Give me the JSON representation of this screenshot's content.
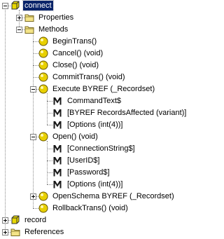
{
  "tree": {
    "nodes": [
      {
        "label": "connect",
        "icon": "module-icon",
        "level": 0,
        "expander": "minus",
        "selected": true
      },
      {
        "label": "Properties",
        "icon": "folder-icon",
        "level": 1,
        "expander": "plus"
      },
      {
        "label": "Methods",
        "icon": "folder-icon",
        "level": 1,
        "expander": "minus"
      },
      {
        "label": "BeginTrans()",
        "icon": "method-icon",
        "level": 2,
        "expander": null
      },
      {
        "label": "Cancel() (void)",
        "icon": "method-icon",
        "level": 2,
        "expander": null
      },
      {
        "label": "Close() (void)",
        "icon": "method-icon",
        "level": 2,
        "expander": null
      },
      {
        "label": "CommitTrans() (void)",
        "icon": "method-icon",
        "level": 2,
        "expander": null
      },
      {
        "label": "Execute BYREF (_Recordset)",
        "icon": "method-icon",
        "level": 2,
        "expander": "minus"
      },
      {
        "label": "CommandText$",
        "icon": "parameter-icon",
        "level": 3,
        "expander": null
      },
      {
        "label": "[BYREF RecordsAffected (variant)]",
        "icon": "parameter-icon",
        "level": 3,
        "expander": null
      },
      {
        "label": "[Options (int(4))]",
        "icon": "parameter-icon",
        "level": 3,
        "expander": null
      },
      {
        "label": "Open() (void)",
        "icon": "method-icon",
        "level": 2,
        "expander": "minus"
      },
      {
        "label": "[ConnectionString$]",
        "icon": "parameter-icon",
        "level": 3,
        "expander": null
      },
      {
        "label": "[UserID$]",
        "icon": "parameter-icon",
        "level": 3,
        "expander": null
      },
      {
        "label": "[Password$]",
        "icon": "parameter-icon",
        "level": 3,
        "expander": null
      },
      {
        "label": "[Options (int(4))]",
        "icon": "parameter-icon",
        "level": 3,
        "expander": null
      },
      {
        "label": "OpenSchema BYREF (_Recordset)",
        "icon": "method-icon",
        "level": 2,
        "expander": "plus"
      },
      {
        "label": "RollbackTrans() (void)",
        "icon": "method-icon",
        "level": 2,
        "expander": null
      },
      {
        "label": "record",
        "icon": "module-icon",
        "level": 0,
        "expander": "plus"
      },
      {
        "label": "References",
        "icon": "folder-icon",
        "level": 0,
        "expander": "plus"
      }
    ]
  },
  "colors": {
    "selection": "#0a246a",
    "method_icon": "#e8d000",
    "folder_icon": "#f4e488",
    "module_icon": "#e8d800"
  }
}
